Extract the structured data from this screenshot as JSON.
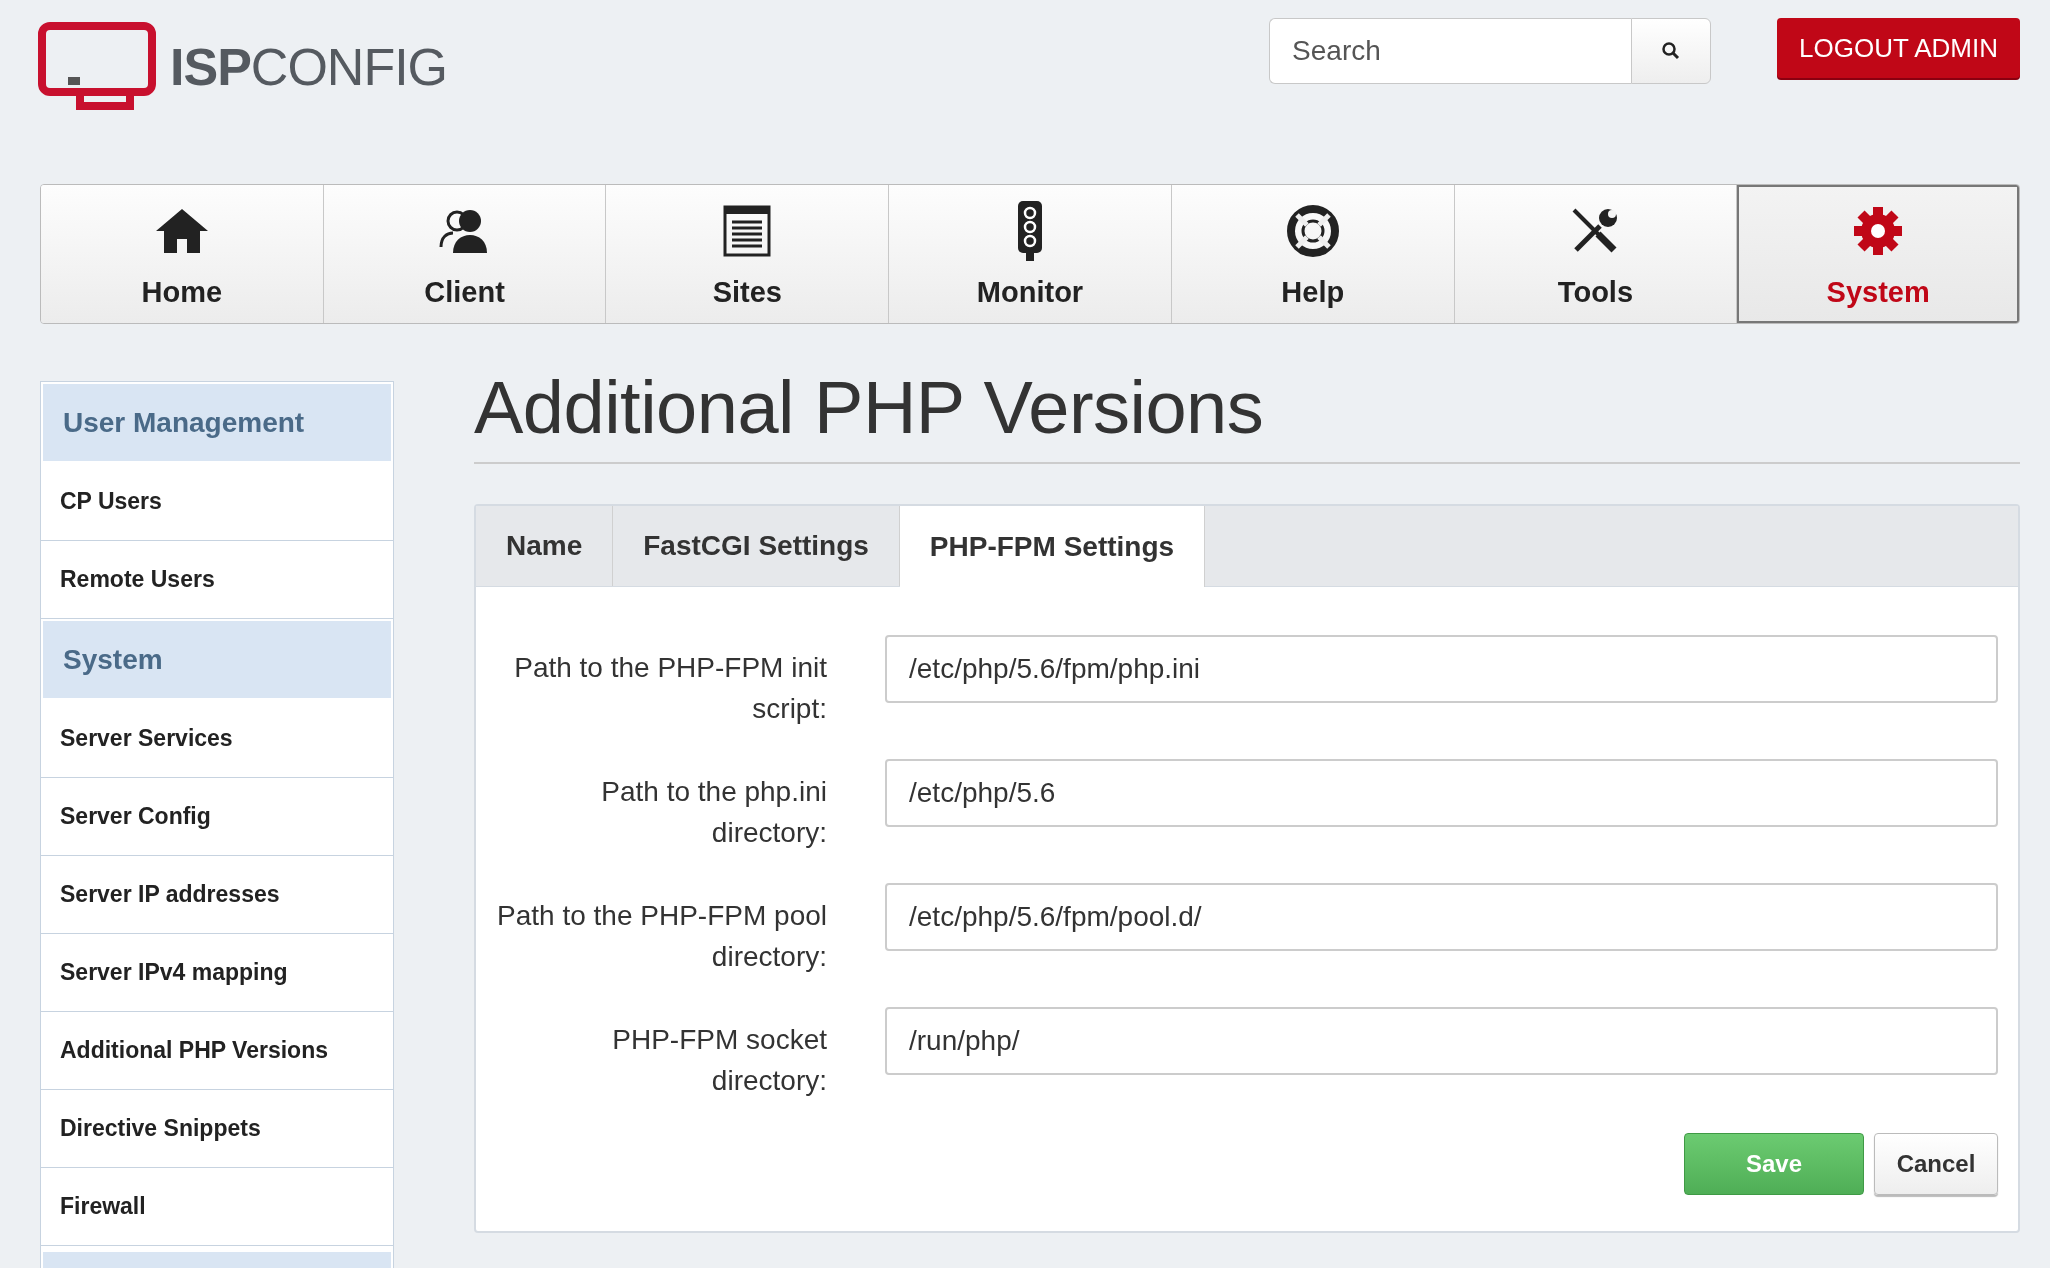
{
  "logo": {
    "text": "**ISP**CONFIG"
  },
  "search": {
    "placeholder": "Search"
  },
  "logout_button": "LOGOUT ADMIN",
  "nav": [
    {
      "label": "Home",
      "kind": "home",
      "selected": false
    },
    {
      "label": "Client",
      "kind": "client",
      "selected": false
    },
    {
      "label": "Sites",
      "kind": "sites",
      "selected": false
    },
    {
      "label": "Monitor",
      "kind": "monitor",
      "selected": false
    },
    {
      "label": "Help",
      "kind": "help",
      "selected": false
    },
    {
      "label": "Tools",
      "kind": "tools",
      "selected": false
    },
    {
      "label": "System",
      "kind": "system",
      "selected": true
    }
  ],
  "sidebar": [
    {
      "kind": "header",
      "label": "User Management"
    },
    {
      "kind": "item",
      "label": "CP Users"
    },
    {
      "kind": "item",
      "label": "Remote Users"
    },
    {
      "kind": "header",
      "label": "System"
    },
    {
      "kind": "item",
      "label": "Server Services"
    },
    {
      "kind": "item",
      "label": "Server Config"
    },
    {
      "kind": "item",
      "label": "Server IP addresses"
    },
    {
      "kind": "item",
      "label": "Server IPv4 mapping"
    },
    {
      "kind": "item",
      "label": "Additional PHP Versions"
    },
    {
      "kind": "item",
      "label": "Directive Snippets"
    },
    {
      "kind": "item",
      "label": "Firewall"
    }
  ],
  "page_title": "Additional PHP Versions",
  "tabs": [
    {
      "label": "Name",
      "selected": false
    },
    {
      "label": "FastCGI Settings",
      "selected": false
    },
    {
      "label": "PHP-FPM Settings",
      "selected": true
    }
  ],
  "fields": [
    {
      "label": "Path to the PHP-FPM init script:",
      "value": "/etc/php/5.6/fpm/php.ini"
    },
    {
      "label": "Path to the php.ini directory:",
      "value": "/etc/php/5.6"
    },
    {
      "label": "Path to the PHP-FPM pool directory:",
      "value": "/etc/php/5.6/fpm/pool.d/"
    },
    {
      "label": "PHP-FPM socket directory:",
      "value": "/run/php/"
    }
  ],
  "buttons": [
    {
      "kind": "primary",
      "label": "Save"
    },
    {
      "kind": "secondary",
      "label": "Cancel"
    }
  ]
}
